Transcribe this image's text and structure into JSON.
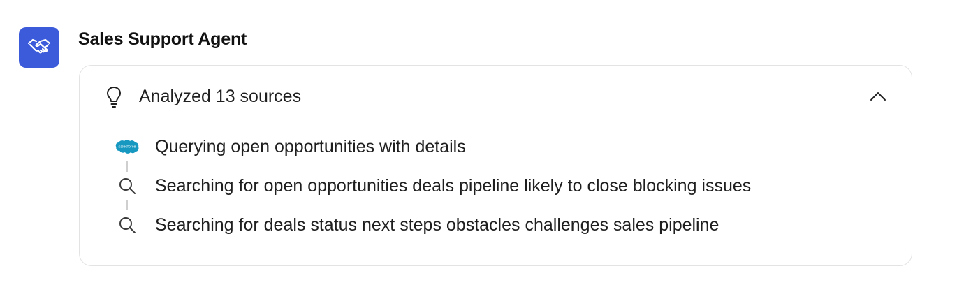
{
  "agent": {
    "name": "Sales Support Agent",
    "avatar_icon": "handshake-icon",
    "avatar_color": "#3b5bdb"
  },
  "sources_panel": {
    "title": "Analyzed 13 sources",
    "header_icon": "lightbulb-icon",
    "toggle_icon": "chevron-up-icon",
    "expanded": true,
    "steps": [
      {
        "icon": "salesforce-icon",
        "label": "Querying open opportunities with details",
        "icon_text": "salesforce"
      },
      {
        "icon": "search-icon",
        "label": "Searching for open opportunities deals pipeline likely to close blocking issues"
      },
      {
        "icon": "search-icon",
        "label": "Searching for deals status next steps obstacles challenges sales pipeline"
      }
    ]
  },
  "colors": {
    "salesforce_blue": "#1798c1",
    "border": "#e3e3e3",
    "text": "#1f1f1f"
  }
}
